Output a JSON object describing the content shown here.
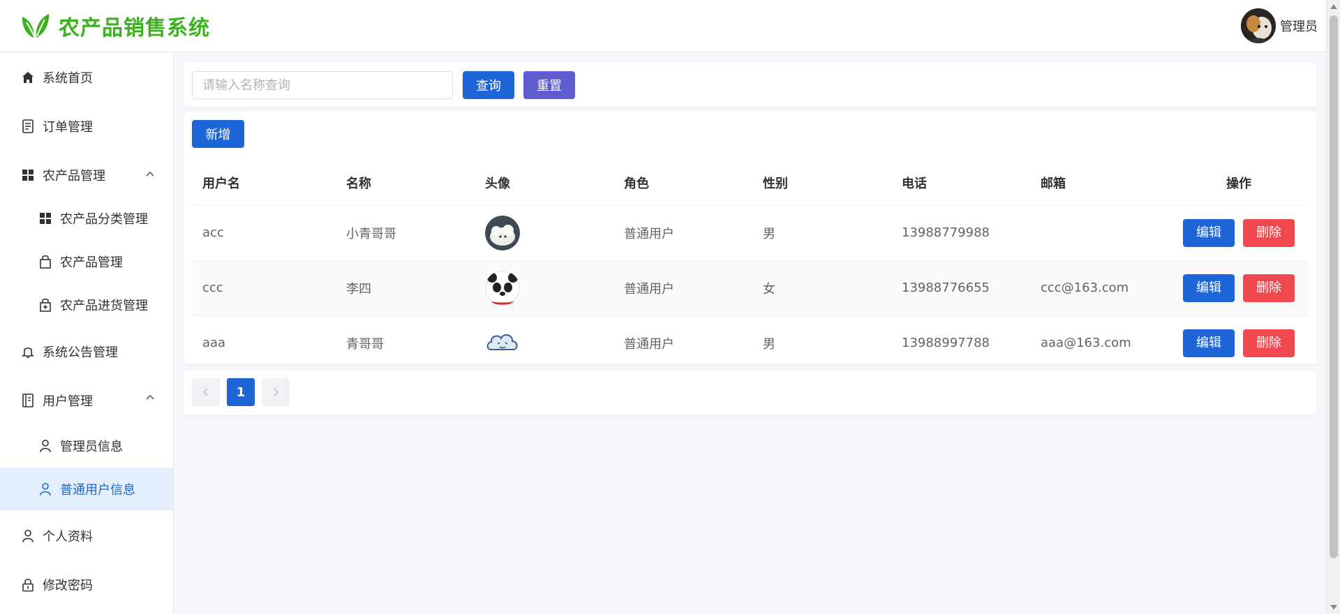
{
  "app": {
    "title": "农产品销售系统",
    "brand_color": "#3bb11d",
    "accent_color": "#1e66d8"
  },
  "header": {
    "user_name": "管理员",
    "avatar_icon": "user-avatar-photo"
  },
  "sidebar": {
    "items": [
      {
        "label": "系统首页",
        "icon": "home-icon"
      },
      {
        "label": "订单管理",
        "icon": "document-icon"
      },
      {
        "label": "农产品管理",
        "icon": "grid-icon",
        "expanded": true
      },
      {
        "label": "农产品分类管理",
        "icon": "grid-icon"
      },
      {
        "label": "农产品管理",
        "icon": "shopping-bag-icon"
      },
      {
        "label": "农产品进货管理",
        "icon": "shopping-bag-plus-icon"
      },
      {
        "label": "系统公告管理",
        "icon": "bell-icon"
      },
      {
        "label": "用户管理",
        "icon": "notebook-icon",
        "expanded": true
      },
      {
        "label": "管理员信息",
        "icon": "user-icon"
      },
      {
        "label": "普通用户信息",
        "icon": "user-icon",
        "active": true
      },
      {
        "label": "个人资料",
        "icon": "user-icon"
      },
      {
        "label": "修改密码",
        "icon": "lock-icon"
      }
    ]
  },
  "search": {
    "placeholder": "请输入名称查询",
    "value": "",
    "query_label": "查询",
    "reset_label": "重置"
  },
  "toolbar": {
    "add_label": "新增"
  },
  "table": {
    "columns": [
      "用户名",
      "名称",
      "头像",
      "角色",
      "性别",
      "电话",
      "邮箱",
      "操作"
    ],
    "rows": [
      {
        "username": "acc",
        "name": "小青哥哥",
        "avatar": "white-fluffy-animal",
        "role": "普通用户",
        "gender": "男",
        "phone": "13988779988",
        "email": ""
      },
      {
        "username": "ccc",
        "name": "李四",
        "avatar": "panda-face",
        "role": "普通用户",
        "gender": "女",
        "phone": "13988776655",
        "email": "ccc@163.com"
      },
      {
        "username": "aaa",
        "name": "青哥哥",
        "avatar": "cloud-face",
        "role": "普通用户",
        "gender": "男",
        "phone": "13988997788",
        "email": "aaa@163.com"
      }
    ],
    "edit_label": "编辑",
    "delete_label": "删除"
  },
  "pagination": {
    "current_page": "1",
    "prev_icon": "chevron-left-icon",
    "next_icon": "chevron-right-icon"
  }
}
